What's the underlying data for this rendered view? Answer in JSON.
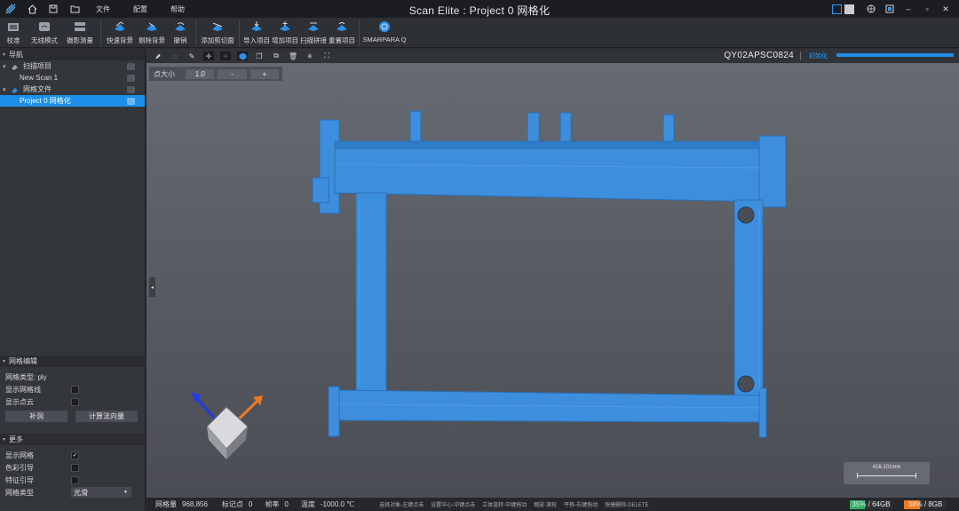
{
  "titlebar": {
    "title": "Scan Elite : Project 0 网格化",
    "menu": [
      "文件",
      "配置",
      "帮助"
    ]
  },
  "toolbar": {
    "items": [
      "校准",
      "无线模式",
      "摄影测量",
      "快速背景",
      "剔除背景",
      "撤销",
      "添加剪切面",
      "导入项目",
      "增加项目",
      "扫描拼接",
      "重置项目",
      "SMARPARA Q"
    ]
  },
  "nav": {
    "title": "导航",
    "tree": [
      {
        "label": "扫描项目"
      },
      {
        "label": "New Scan 1"
      },
      {
        "label": "网格文件"
      },
      {
        "label": "Project 0 网格化"
      }
    ]
  },
  "mesh_edit": {
    "title": "网格编辑",
    "mesh_type_label": "网格类型: ply",
    "show_mesh_lines": "显示网格线",
    "show_point_cloud": "显示点云",
    "fill_hole": "补洞",
    "compute_normal": "计算法向量"
  },
  "more": {
    "title": "更多",
    "show_mesh": "显示网格",
    "show_mesh_checked": true,
    "color_guide": "色彩引导",
    "feature_guide": "特征引导",
    "mesh_type": "网格类型",
    "mesh_type_value": "光滑"
  },
  "viewport": {
    "scanner_id": "QY02APSC0824",
    "status": "初始化",
    "point_size_label": "点大小",
    "point_size_value": "1.0",
    "minus": "-",
    "plus": "+",
    "scale_text": "416.101mm"
  },
  "statusbar": {
    "mesh_count_label": "网格量",
    "mesh_count": "968,856",
    "markers_label": "标记点",
    "markers": "0",
    "fps_label": "帧率",
    "fps": "0",
    "temp_label": "温度",
    "temp": "-1000.0 ℃",
    "hints": [
      "选择对象-左键点击",
      "设置中心-中键点击",
      "立体旋转-中键拖动",
      "缩放-滚轮",
      "平移-右键拖动",
      "快捷删除-DELETE"
    ],
    "mem1": "35% / 64GB",
    "mem1_pct": 35,
    "mem2": "38% / 8GB",
    "mem2_pct": 38
  },
  "colors": {
    "accent": "#1c8fea",
    "model": "#3d8fdd",
    "mem1": "#2fae5e",
    "mem2": "#f07a1a"
  }
}
